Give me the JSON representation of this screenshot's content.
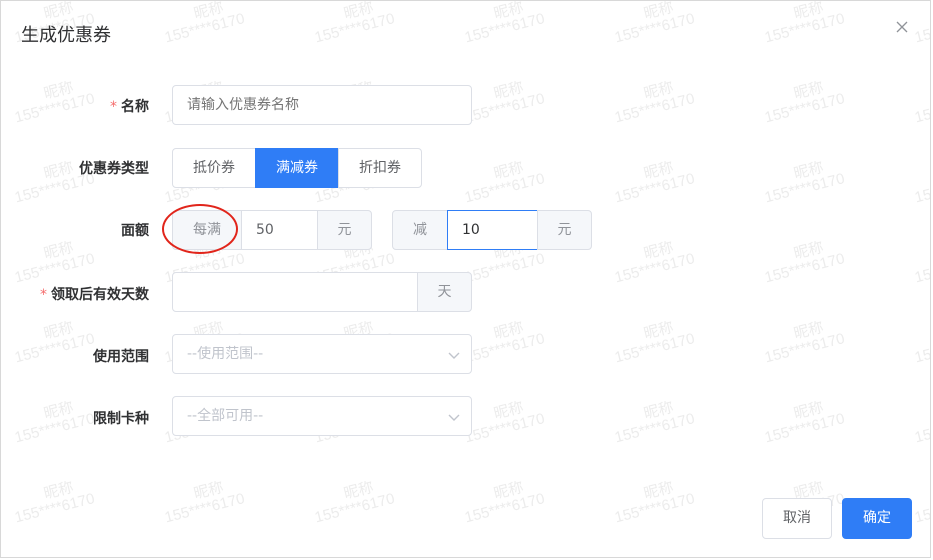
{
  "dialog": {
    "title": "生成优惠券",
    "close_icon": "close-icon"
  },
  "watermark": {
    "line1": "昵称",
    "line2": "155****6170"
  },
  "form": {
    "name": {
      "required_mark": "*",
      "label": "名称",
      "placeholder": "请输入优惠券名称",
      "value": ""
    },
    "coupon_type": {
      "label": "优惠券类型",
      "options": [
        "抵价券",
        "满减券",
        "折扣券"
      ],
      "selected": "满减券"
    },
    "amount": {
      "label": "面额",
      "threshold_prefix": "每满",
      "threshold_value": "50",
      "threshold_unit": "元",
      "discount_prefix": "减",
      "discount_value": "10",
      "discount_unit": "元"
    },
    "valid_days": {
      "required_mark": "*",
      "label": "领取后有效天数",
      "value": "",
      "unit": "天"
    },
    "scope": {
      "label": "使用范围",
      "placeholder": "--使用范围--"
    },
    "card_type": {
      "label": "限制卡种",
      "placeholder": "--全部可用--"
    }
  },
  "footer": {
    "cancel_label": "取消",
    "confirm_label": "确定"
  },
  "colors": {
    "primary": "#2f7df6",
    "required": "#f56c6c",
    "annotation_circle": "#e1251b"
  }
}
